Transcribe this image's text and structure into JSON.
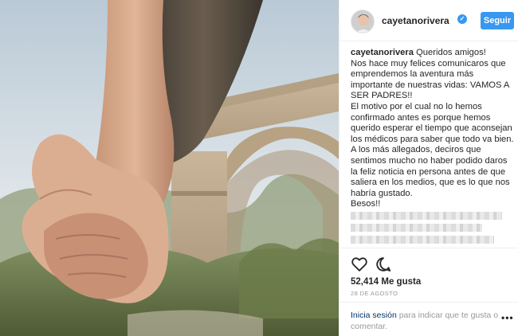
{
  "post": {
    "username": "cayetanorivera",
    "follow_label": "Seguir",
    "caption_author": "cayetanorivera",
    "caption_lines": [
      "Queridos amigos!",
      "Nos hace muy felices comunicaros que emprendemos la aventura más importante de nuestras vidas: VAMOS A SER PADRES!!",
      "El motivo por el cual no lo hemos confirmado antes es porque hemos querido esperar el tiempo que aconsejan los médicos para saber que todo va bien.",
      "A los más allegados, deciros que sentimos mucho no haber podido daros la feliz noticia en persona antes de que saliera en los medios, que es lo que nos habría gustado.",
      "Besos!!"
    ],
    "likes": "52,414 Me gusta",
    "date": "28 DE AGOSTO"
  },
  "footer": {
    "login_label": "Inicia sesión",
    "rest_text": " para indicar que te gusta o comentar.",
    "more_label": "•••"
  },
  "icons": {
    "verified": "verified-badge-icon",
    "like": "heart-icon",
    "comment": "comment-icon",
    "more": "more-options-icon"
  },
  "colors": {
    "accent": "#3897f0",
    "link": "#003569",
    "muted": "#999999"
  }
}
